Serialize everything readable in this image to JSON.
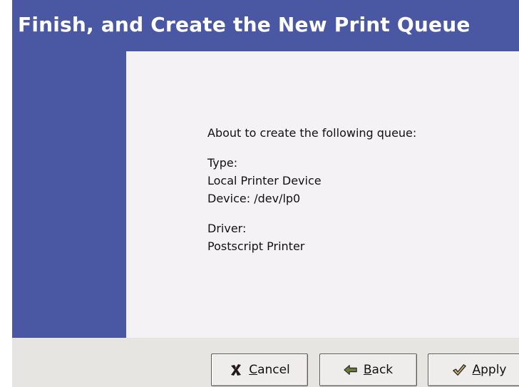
{
  "dialog": {
    "title": "Finish, and Create the New Print Queue"
  },
  "summary": {
    "intro": "About to create the following queue:",
    "type_label": "Type:",
    "type_value": "Local Printer Device",
    "device": "Device: /dev/lp0",
    "driver_label": "Driver:",
    "driver_value": "Postscript Printer"
  },
  "buttons": {
    "cancel": {
      "label": "Cancel",
      "icon": "x-cross-icon"
    },
    "back": {
      "label": "Back",
      "icon": "back-arrow-icon"
    },
    "apply": {
      "label": "Apply",
      "icon": "checkmark-icon"
    }
  },
  "colors": {
    "header_blue": "#4a58a4",
    "content_bg": "#f4f2f5",
    "window_bg": "#e6e5e2"
  }
}
